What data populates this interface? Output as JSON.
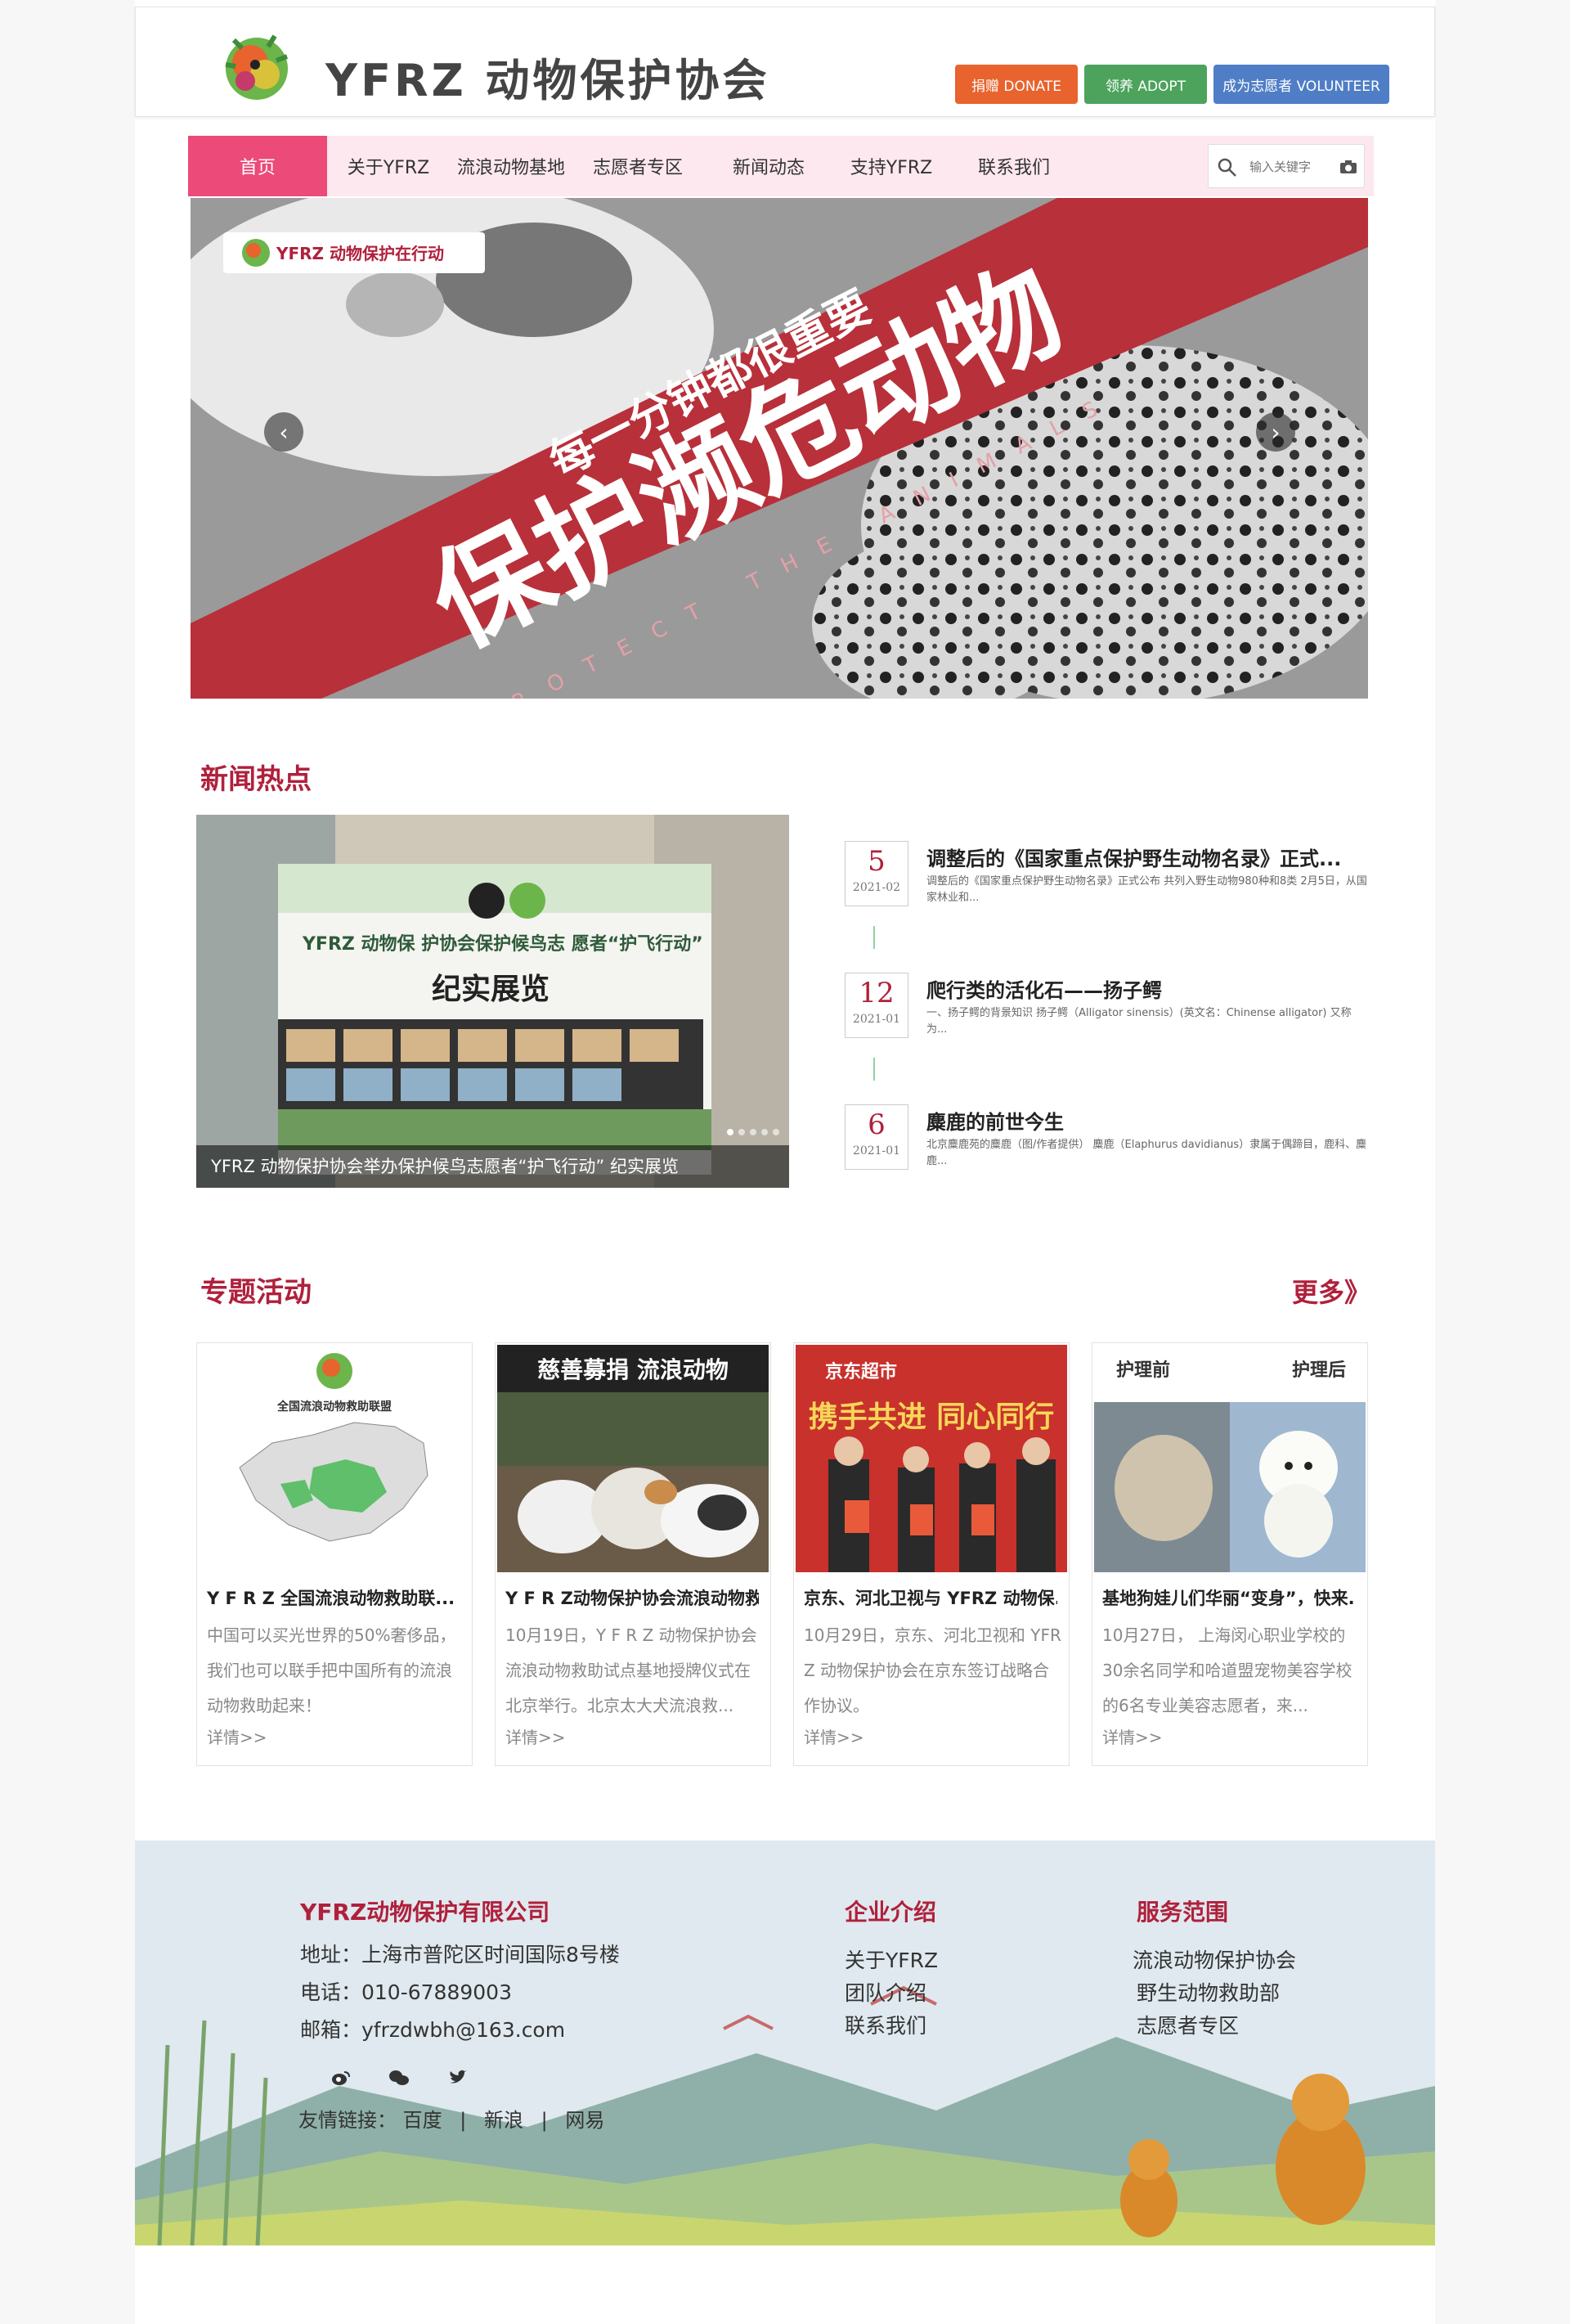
{
  "header": {
    "brand": "YFRZ 动物保护协会",
    "donate": "捐赠 DONATE",
    "adopt": "领养 ADOPT",
    "volunteer": "成为志愿者 VOLUNTEER"
  },
  "nav": {
    "items": [
      "首页",
      "关于YFRZ",
      "流浪动物基地",
      "志愿者专区",
      "新闻动态",
      "支持YFRZ",
      "联系我们"
    ],
    "search_placeholder": "输入关键字"
  },
  "banner": {
    "badge": "YFRZ 动物保护在行动",
    "slogan_small": "每一分钟都很重要",
    "slogan_big": "保护濒危动物",
    "slogan_en": "PROTECT THE ANIMALS"
  },
  "news": {
    "section_title": "新闻热点",
    "image_caption": "YFRZ 动物保护协会举办保护候鸟志愿者“护飞行动” 纪实展览",
    "image_sign1": "YFRZ 动物保 护协会保护候鸟志 愿者“护飞行动”",
    "image_sign2": "纪实展览",
    "items": [
      {
        "day": "5",
        "ym": "2021-02",
        "title": "调整后的《国家重点保护野生动物名录》正式...",
        "desc": "调整后的《国家重点保护野生动物名录》正式公布 共列入野生动物980种和8类 2月5日，从国家林业和..."
      },
      {
        "day": "12",
        "ym": "2021-01",
        "title": "爬行类的活化石——扬子鳄",
        "desc": "一、扬子鳄的背景知识 扬子鳄（Alligator sinensis）(英文名：Chinense alligator) 又称为..."
      },
      {
        "day": "6",
        "ym": "2021-01",
        "title": "麋鹿的前世今生",
        "desc": "北京麋鹿苑的麋鹿（图/作者提供） 麋鹿（Elaphurus davidianus）隶属于偶蹄目，鹿科、麋鹿..."
      }
    ]
  },
  "topics": {
    "section_title": "专题活动",
    "more": "更多》",
    "cards": [
      {
        "img_label": "全国流浪动物救助联盟",
        "title": "Y F R Z 全国流浪动物救助联...",
        "desc": "中国可以买光世界的50%奢侈品，我们也可以联手把中国所有的流浪动物救助起来！",
        "link": "详情>>"
      },
      {
        "img_label": "慈善募捐 流浪动物",
        "title": "Y F R Z动物保护协会流浪动物救...",
        "desc": "10月19日，Y F R Z 动物保护协会流浪动物救助试点基地授牌仪式在北京举行。北京太大犬流浪救...",
        "link": "详情>>"
      },
      {
        "img_label": "京东超市",
        "img_label2": "携手共进 同心同行",
        "title": "京东、河北卫视与 YFRZ 动物保...",
        "desc": "10月29日，京东、河北卫视和 YFR Z 动物保护协会在京东签订战略合作协议。",
        "link": "详情>>"
      },
      {
        "img_label": "护理前",
        "img_label2": "护理后",
        "title": "基地狗娃儿们华丽“变身”，快来...",
        "desc": "10月27日， 上海闵心职业学校的30余名同学和哈道盟宠物美容学校的6名专业美容志愿者，来...",
        "link": "详情>>"
      }
    ]
  },
  "footer": {
    "company": "YFRZ动物保护有限公司",
    "address": "地址：上海市普陀区时间国际8号楼",
    "phone": "电话：010-67889003",
    "email": "邮箱：yfrzdwbh@163.com",
    "col2_title": "企业介绍",
    "col2_items": [
      "关于YFRZ",
      "团队介绍",
      "联系我们"
    ],
    "col3_title": "服务范围",
    "col3_items": [
      "流浪动物保护协会",
      "野生动物救助部",
      "志愿者专区"
    ],
    "links_label": "友情链接：",
    "links": [
      "百度",
      "新浪",
      "网易"
    ],
    "separator": "|"
  },
  "colors": {
    "accent": "#b0203c",
    "nav_active": "#ec4a79",
    "banner_red": "#b8303a"
  }
}
